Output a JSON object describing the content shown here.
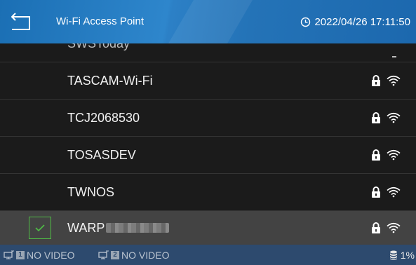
{
  "header": {
    "title": "Wi-Fi Access Point",
    "datetime": "2022/04/26 17:11:50"
  },
  "networks": [
    {
      "ssid": "SWSToday",
      "partial": true
    },
    {
      "ssid": "TASCAM-Wi-Fi",
      "secured": true
    },
    {
      "ssid": "TCJ2068530",
      "secured": true
    },
    {
      "ssid": "TOSASDEV",
      "secured": true
    },
    {
      "ssid": "TWNOS",
      "secured": true
    },
    {
      "ssid": "WARP",
      "secured": true,
      "selected": true,
      "ssid_obscured": true
    }
  ],
  "status": {
    "video1_num": "1",
    "video1_label": "NO VIDEO",
    "video2_num": "2",
    "video2_label": "NO VIDEO",
    "storage": "1%"
  },
  "colors": {
    "header": "#1f6fb5",
    "selected_row": "#434343",
    "check": "#4fbd45",
    "statusbar": "#2d4a6e"
  }
}
